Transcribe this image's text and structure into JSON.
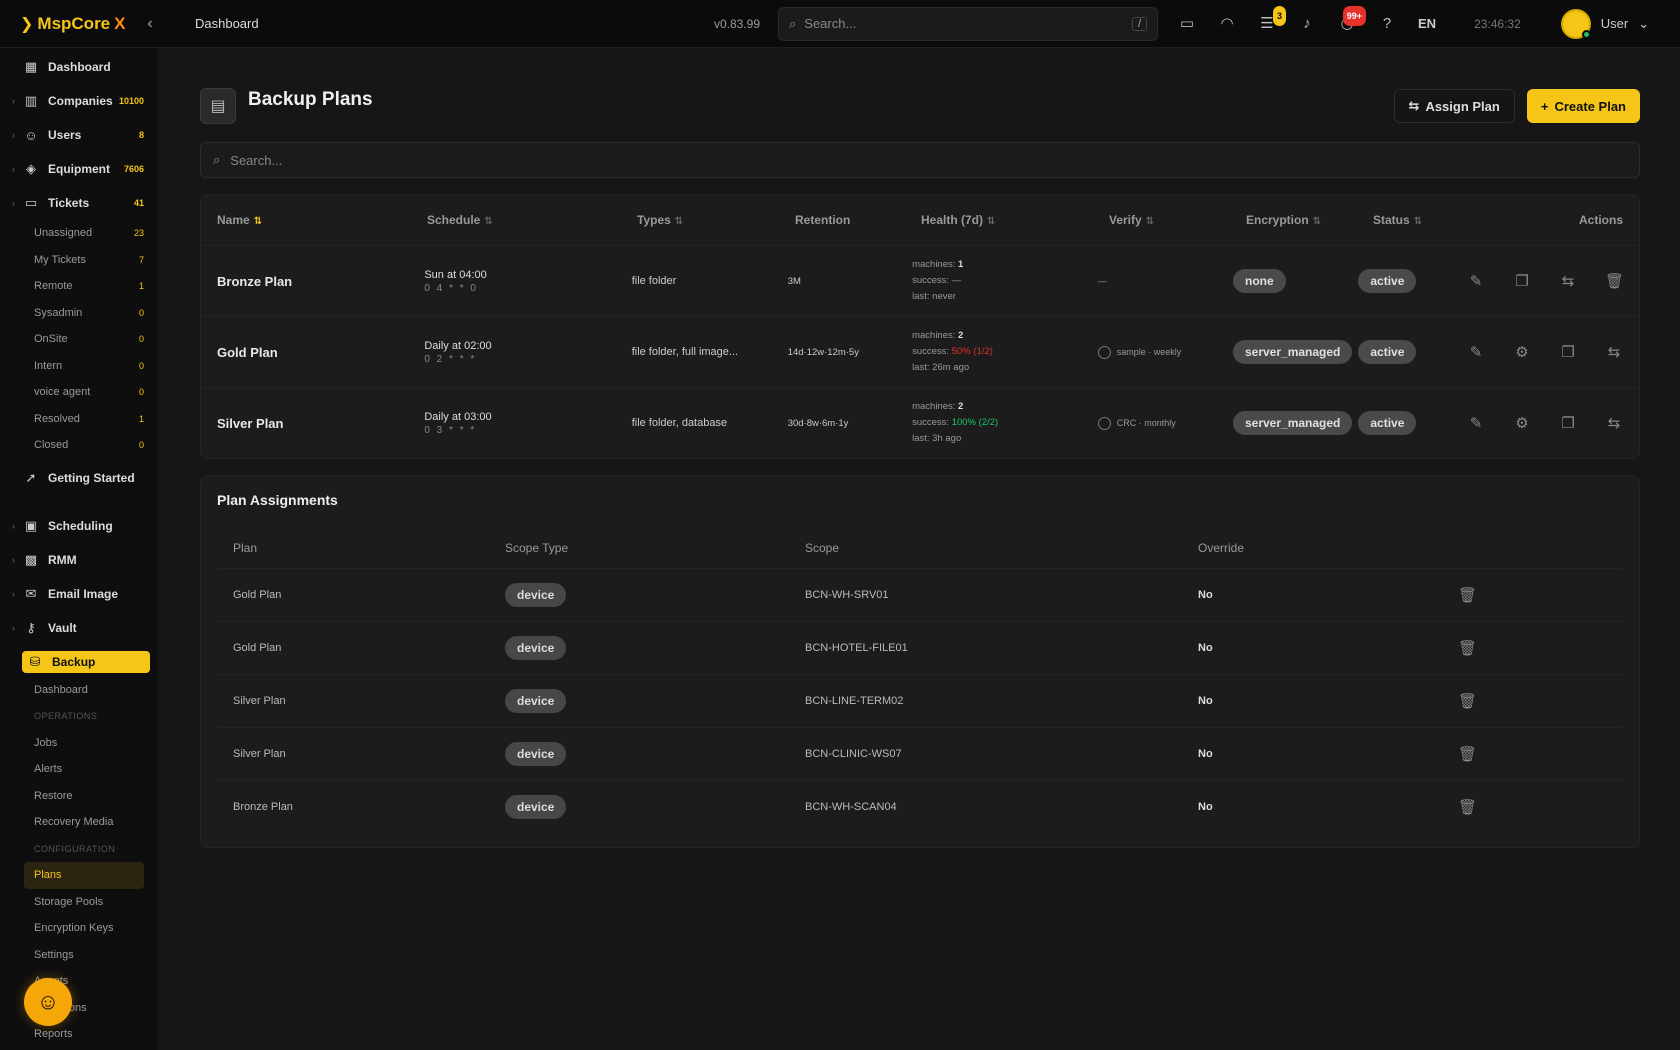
{
  "app": {
    "logo_prefix": "MspCore",
    "logo_suffix": "X",
    "breadcrumb": "Dashboard",
    "version": "v0.83.99",
    "search_placeholder": "Search...",
    "search_kbd": "/",
    "badge_chat": "3",
    "badge_alert": "99+",
    "lang": "EN",
    "clock": "23:46:32",
    "user": "User"
  },
  "sidebar": {
    "items_top": [
      {
        "label": "Dashboard",
        "icon": "grid-icon",
        "count": ""
      },
      {
        "label": "Companies",
        "icon": "building-icon",
        "count": "10100"
      },
      {
        "label": "Users",
        "icon": "users-icon",
        "count": "8"
      },
      {
        "label": "Equipment",
        "icon": "shield-icon",
        "count": "7606"
      },
      {
        "label": "Tickets",
        "icon": "ticket-icon",
        "count": "41"
      }
    ],
    "ticket_subs": [
      {
        "label": "Unassigned",
        "count": "23"
      },
      {
        "label": "My Tickets",
        "count": "7"
      },
      {
        "label": "Remote",
        "count": "1"
      },
      {
        "label": "Sysadmin",
        "count": "0"
      },
      {
        "label": "OnSite",
        "count": "0"
      },
      {
        "label": "Intern",
        "count": "0"
      },
      {
        "label": "voice agent",
        "count": "0"
      },
      {
        "label": "Resolved",
        "count": "1"
      },
      {
        "label": "Closed",
        "count": "0"
      }
    ],
    "getting_started": "Getting Started",
    "items_mid": [
      {
        "label": "Scheduling",
        "icon": "calendar-icon"
      },
      {
        "label": "RMM",
        "icon": "rmm-icon"
      },
      {
        "label": "Email Image",
        "icon": "mail-icon"
      },
      {
        "label": "Vault",
        "icon": "key-icon"
      }
    ],
    "backup": "Backup",
    "backup_subs": [
      {
        "label": "Dashboard",
        "type": "item"
      },
      {
        "label": "OPERATIONS",
        "type": "header"
      },
      {
        "label": "Jobs",
        "type": "item"
      },
      {
        "label": "Alerts",
        "type": "item"
      },
      {
        "label": "Restore",
        "type": "item"
      },
      {
        "label": "Recovery Media",
        "type": "item"
      },
      {
        "label": "CONFIGURATION",
        "type": "header"
      },
      {
        "label": "Plans",
        "type": "active"
      },
      {
        "label": "Storage Pools",
        "type": "item"
      },
      {
        "label": "Encryption Keys",
        "type": "item"
      },
      {
        "label": "Settings",
        "type": "item"
      },
      {
        "label": "Agents",
        "type": "item"
      },
      {
        "label": "Retentions",
        "type": "item"
      },
      {
        "label": "Reports",
        "type": "item"
      }
    ]
  },
  "page": {
    "title": "Backup Plans",
    "assign_label": "Assign Plan",
    "create_label": "Create Plan",
    "search_placeholder": "Search..."
  },
  "plans": {
    "headers": {
      "name": "Name",
      "schedule": "Schedule",
      "types": "Types",
      "retention": "Retention",
      "health": "Health (7d)",
      "verify": "Verify",
      "encryption": "Encryption",
      "status": "Status",
      "actions": "Actions"
    },
    "rows": [
      {
        "name": "Bronze Plan",
        "sched1": "Sun at 04:00",
        "sched2": "0 4 * * 0",
        "types": "file folder",
        "retention": "3M",
        "machines": "1",
        "success": "—",
        "success_cls": "",
        "last": "never",
        "verify": "—",
        "verify_icon": false,
        "encryption": "none",
        "status": "active"
      },
      {
        "name": "Gold Plan",
        "sched1": "Daily at 02:00",
        "sched2": "0 2 * * *",
        "types": "file folder, full image...",
        "retention": "14d·12w·12m·5y",
        "machines": "2",
        "success": "50% (1/2)",
        "success_cls": "red",
        "last": "26m ago",
        "verify": "sample · weekly",
        "verify_icon": true,
        "encryption": "server_managed",
        "status": "active"
      },
      {
        "name": "Silver Plan",
        "sched1": "Daily at 03:00",
        "sched2": "0 3 * * *",
        "types": "file folder, database",
        "retention": "30d·8w·6m·1y",
        "machines": "2",
        "success": "100% (2/2)",
        "success_cls": "green",
        "last": "3h ago",
        "verify": "CRC · monthly",
        "verify_icon": true,
        "encryption": "server_managed",
        "status": "active"
      }
    ],
    "labels": {
      "machines": "machines:",
      "success": "success:",
      "last": "last:"
    }
  },
  "assignments": {
    "title": "Plan Assignments",
    "headers": {
      "plan": "Plan",
      "scope_type": "Scope Type",
      "scope": "Scope",
      "override": "Override"
    },
    "rows": [
      {
        "plan": "Gold Plan",
        "scope_type": "device",
        "scope": "BCN-WH-SRV01",
        "override": "No"
      },
      {
        "plan": "Gold Plan",
        "scope_type": "device",
        "scope": "BCN-HOTEL-FILE01",
        "override": "No"
      },
      {
        "plan": "Silver Plan",
        "scope_type": "device",
        "scope": "BCN-LINE-TERM02",
        "override": "No"
      },
      {
        "plan": "Silver Plan",
        "scope_type": "device",
        "scope": "BCN-CLINIC-WS07",
        "override": "No"
      },
      {
        "plan": "Bronze Plan",
        "scope_type": "device",
        "scope": "BCN-WH-SCAN04",
        "override": "No"
      }
    ]
  },
  "colors": {
    "accent": "#f5c518",
    "success": "#1ec46a",
    "danger": "#e5322d"
  }
}
